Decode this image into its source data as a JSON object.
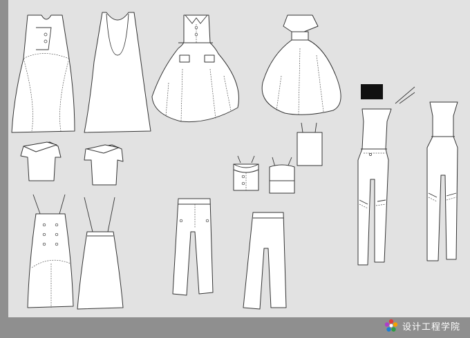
{
  "watermark": {
    "text": "设计工程学院",
    "logo_icon": "flower-logo-icon",
    "logo_colors": [
      "#e23b3b",
      "#2f9e44",
      "#1c7ed6",
      "#f59f00",
      "#ae3ec9"
    ]
  },
  "colors": {
    "background": "#e2e2e2",
    "frame": "#8f8f8f",
    "garment_fill": "#ffffff",
    "outline": "#333333",
    "swatch": "#111111"
  }
}
